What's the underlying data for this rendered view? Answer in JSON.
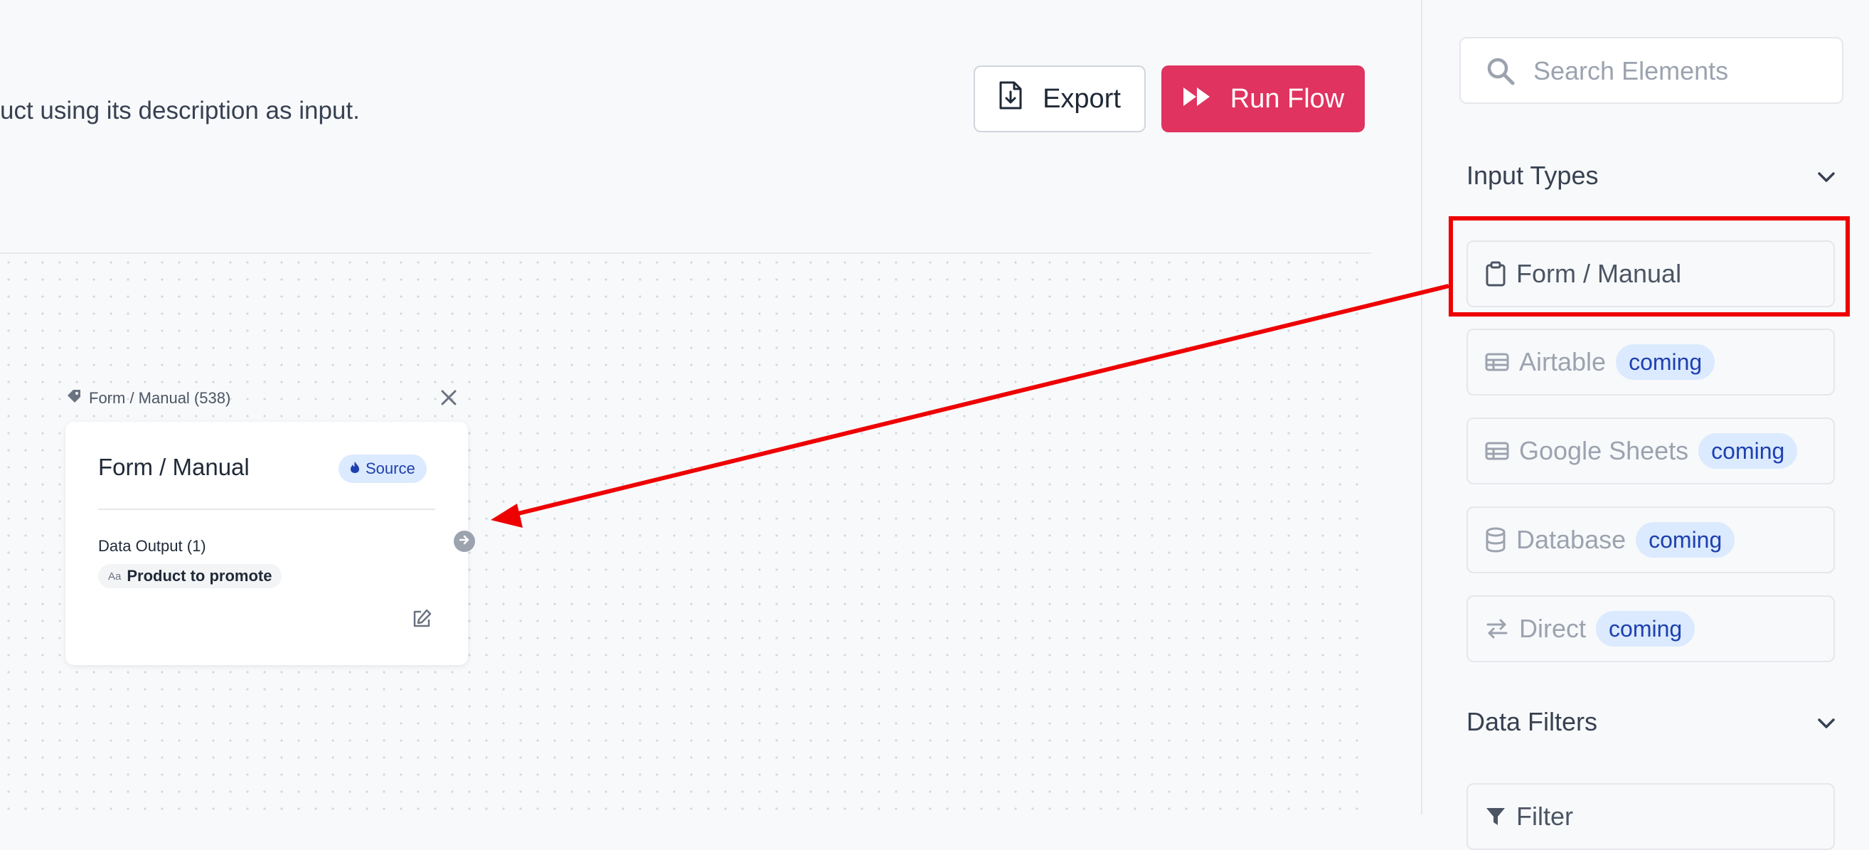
{
  "header": {
    "description": "uct using its description as input.",
    "export_label": "Export",
    "run_label": "Run Flow"
  },
  "node": {
    "tag_label": "Form / Manual (538)",
    "title": "Form / Manual",
    "badge_label": "Source",
    "output_label": "Data Output (1)",
    "chip_prefix": "Aa",
    "chip_label": "Product to promote"
  },
  "sidebar": {
    "search_placeholder": "Search Elements",
    "input_types": {
      "heading": "Input Types",
      "items": [
        {
          "label": "Form / Manual",
          "icon": "clipboard-icon"
        },
        {
          "label": "Airtable",
          "badge": "coming",
          "icon": "table-icon"
        },
        {
          "label": "Google Sheets",
          "badge": "coming",
          "icon": "table-icon"
        },
        {
          "label": "Database",
          "badge": "coming",
          "icon": "database-icon"
        },
        {
          "label": "Direct",
          "badge": "coming",
          "icon": "arrows-exchange-icon"
        }
      ]
    },
    "data_filters": {
      "heading": "Data Filters",
      "items": [
        {
          "label": "Filter",
          "icon": "filter-icon"
        }
      ]
    }
  },
  "colors": {
    "accent": "#e0335f",
    "badge_bg": "#dbeafe",
    "badge_text": "#1e40af",
    "annotation": "#ee0000"
  }
}
